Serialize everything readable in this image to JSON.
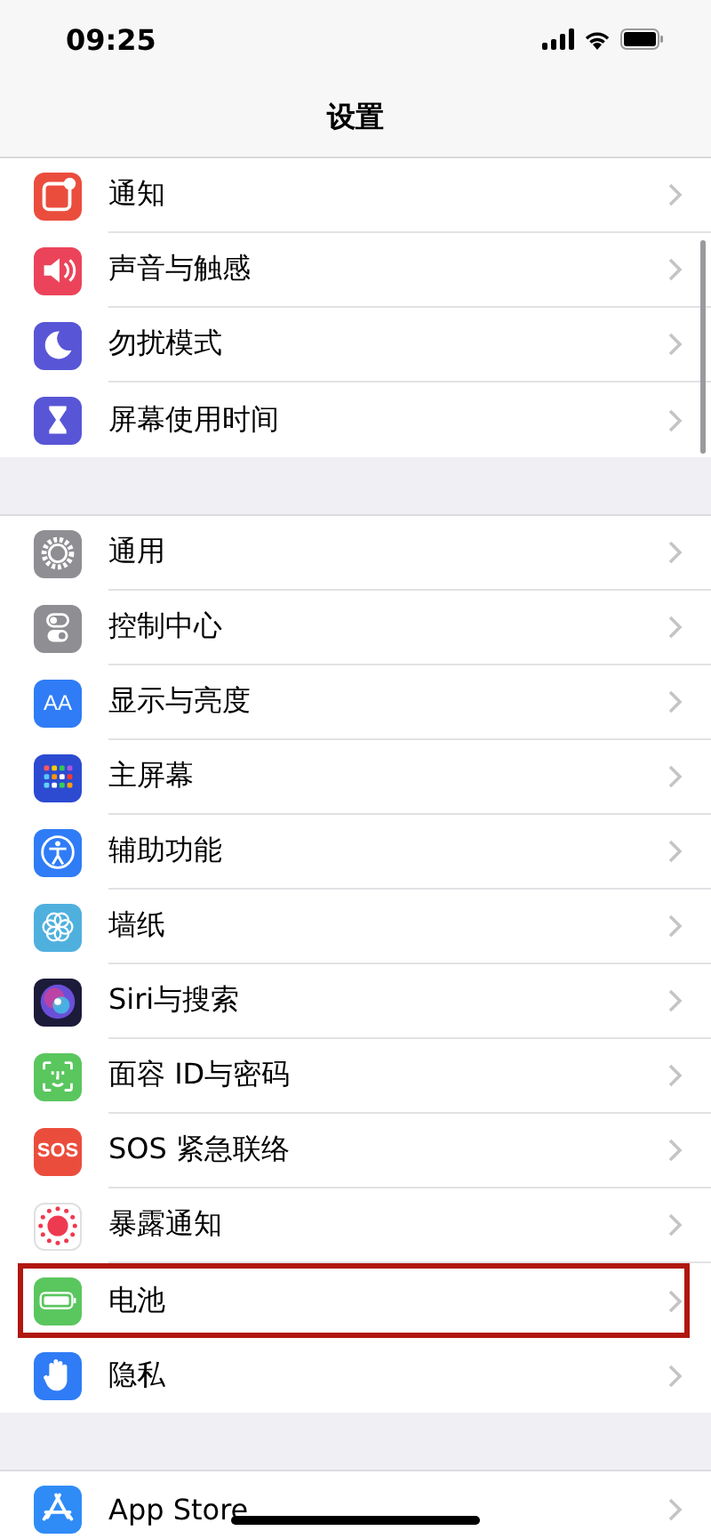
{
  "status_bar": {
    "time": "09:25"
  },
  "nav_bar": {
    "title": "设置"
  },
  "groups": [
    {
      "items": [
        {
          "label": "通知",
          "kind": "notifications",
          "highlighted": false
        },
        {
          "label": "声音与触感",
          "kind": "sounds",
          "highlighted": false
        },
        {
          "label": "勿扰模式",
          "kind": "focus",
          "highlighted": false
        },
        {
          "label": "屏幕使用时间",
          "kind": "screen_time",
          "highlighted": false
        }
      ]
    },
    {
      "items": [
        {
          "label": "通用",
          "kind": "general",
          "highlighted": false
        },
        {
          "label": "控制中心",
          "kind": "control_center",
          "highlighted": false
        },
        {
          "label": "显示与亮度",
          "kind": "display",
          "icon_text": "AA",
          "highlighted": false
        },
        {
          "label": "主屏幕",
          "kind": "home_screen",
          "highlighted": false
        },
        {
          "label": "辅助功能",
          "kind": "accessibility",
          "highlighted": false
        },
        {
          "label": "墙纸",
          "kind": "wallpaper",
          "highlighted": false
        },
        {
          "label": "Siri与搜索",
          "kind": "siri",
          "highlighted": false
        },
        {
          "label": "面容 ID与密码",
          "kind": "face_id",
          "highlighted": false
        },
        {
          "label": "SOS 紧急联络",
          "kind": "sos",
          "icon_text": "SOS",
          "highlighted": false
        },
        {
          "label": "暴露通知",
          "kind": "exposure",
          "highlighted": false
        },
        {
          "label": "电池",
          "kind": "battery",
          "highlighted": true
        },
        {
          "label": "隐私",
          "kind": "privacy",
          "highlighted": false
        }
      ]
    },
    {
      "items": [
        {
          "label": "App Store",
          "kind": "app_store",
          "highlighted": false
        }
      ]
    }
  ]
}
